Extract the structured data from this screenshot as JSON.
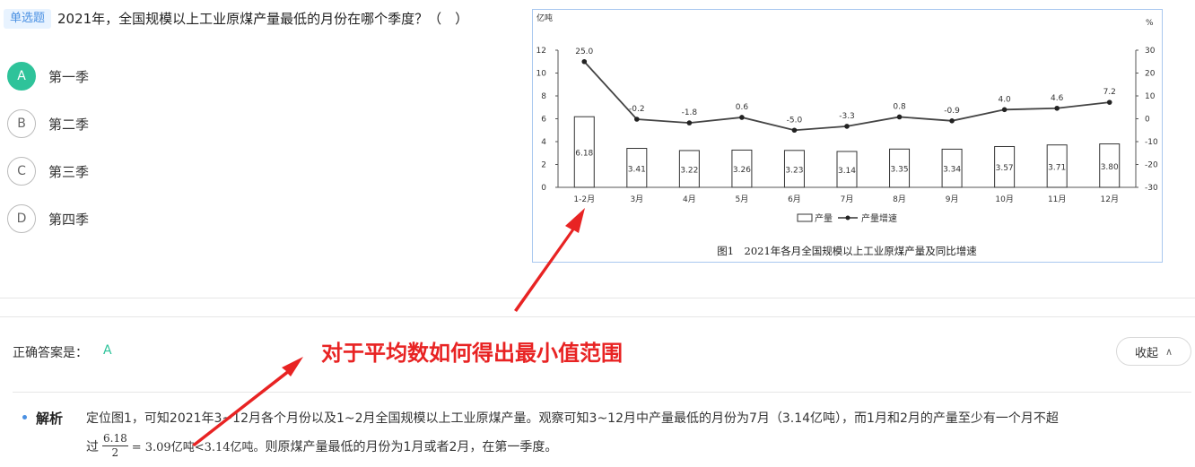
{
  "question": {
    "tag": "单选题",
    "text": "2021年，全国规模以上工业原煤产量最低的月份在哪个季度？（　）"
  },
  "options": [
    {
      "letter": "A",
      "label": "第一季",
      "selected": true
    },
    {
      "letter": "B",
      "label": "第二季",
      "selected": false
    },
    {
      "letter": "C",
      "label": "第三季",
      "selected": false
    },
    {
      "letter": "D",
      "label": "第四季",
      "selected": false
    }
  ],
  "chart_data": {
    "type": "bar",
    "title": "",
    "caption": "图1　2021年各月全国规模以上工业原煤产量及同比增速",
    "y_left_unit": "亿吨",
    "y_right_unit": "%",
    "ylim_left": [
      0,
      12
    ],
    "ylim_right": [
      -30,
      30
    ],
    "y_left_ticks": [
      0,
      2,
      4,
      6,
      8,
      10,
      12
    ],
    "y_right_ticks": [
      30,
      20,
      10,
      0,
      -10,
      -20,
      -30
    ],
    "categories": [
      "1-2月",
      "3月",
      "4月",
      "5月",
      "6月",
      "7月",
      "8月",
      "9月",
      "10月",
      "11月",
      "12月"
    ],
    "series": [
      {
        "name": "产量",
        "type": "bar",
        "axis": "left",
        "values": [
          6.18,
          3.41,
          3.22,
          3.26,
          3.23,
          3.14,
          3.35,
          3.34,
          3.57,
          3.71,
          3.8
        ],
        "labels": [
          "6.18",
          "3.41",
          "3.22",
          "3.26",
          "3.23",
          "3.14",
          "3.35",
          "3.34",
          "3.57",
          "3.71",
          "3.80"
        ]
      },
      {
        "name": "产量增速",
        "type": "line",
        "axis": "right",
        "values": [
          25.0,
          -0.2,
          -1.8,
          0.6,
          -5.0,
          -3.3,
          0.8,
          -0.9,
          4.0,
          4.6,
          7.2
        ],
        "labels": [
          "25.0",
          "-0.2",
          "-1.8",
          "0.6",
          "-5.0",
          "-3.3",
          "0.8",
          "-0.9",
          "4.0",
          "4.6",
          "7.2"
        ]
      }
    ],
    "legend_placement": "bottom-center"
  },
  "answer": {
    "label": "正确答案是：",
    "value": "A"
  },
  "annotation": "对于平均数如何得出最小值范围",
  "collapse_label": "收起",
  "explanation": {
    "title": "解析",
    "line1": "定位图1，可知2021年3~12月各个月份以及1~2月全国规模以上工业原煤产量。观察可知3~12月中产量最低的月份为7月（3.14亿吨），而1月和2月的产量至少有一个月不超",
    "line2_prefix": "过",
    "frac_num": "6.18",
    "frac_den": "2",
    "math": "= 3.09亿吨<3.14亿吨。",
    "line2_suffix": "则原煤产量最低的月份为1月或者2月，在第一季度。"
  },
  "colors": {
    "accent": "#2ec39a",
    "annotation": "#e82323",
    "tag_bg": "#e8f3ff",
    "tag_text": "#4a90e2"
  }
}
